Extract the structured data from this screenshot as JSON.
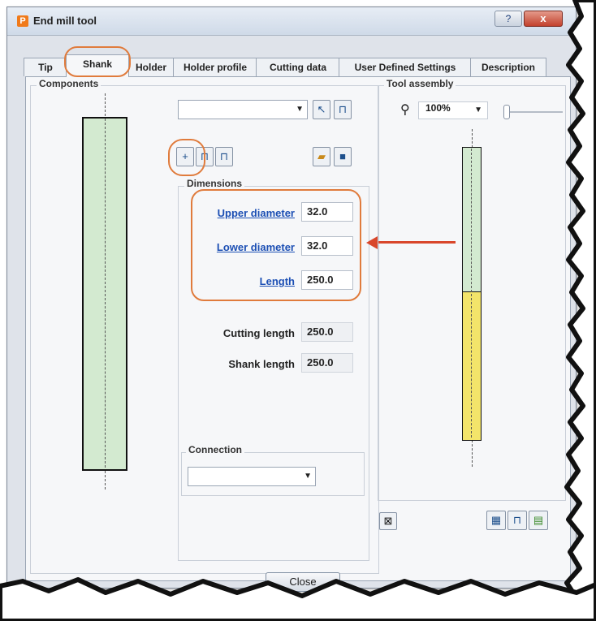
{
  "window": {
    "title": "End mill tool",
    "help_label": "?",
    "close_label": "x"
  },
  "tabs": [
    {
      "label": "Tip",
      "active": false
    },
    {
      "label": "Shank",
      "active": true
    },
    {
      "label": "Holder",
      "active": false
    },
    {
      "label": "Holder profile",
      "active": false
    },
    {
      "label": "Cutting data",
      "active": false
    },
    {
      "label": "User Defined Settings",
      "active": false
    },
    {
      "label": "Description",
      "active": false
    }
  ],
  "components": {
    "label": "Components"
  },
  "toolbar": {
    "component_select_value": "",
    "icons": [
      "select-pointer-icon",
      "select-shank-icon",
      "add-shank-icon",
      "shank-variant-icon",
      "shank-align-icon",
      "open-folder-icon",
      "save-icon"
    ]
  },
  "dimensions": {
    "label": "Dimensions",
    "upper_diameter_label": "Upper diameter",
    "upper_diameter_value": "32.0",
    "lower_diameter_label": "Lower diameter",
    "lower_diameter_value": "32.0",
    "length_label": "Length",
    "length_value": "250.0",
    "cutting_length_label": "Cutting length",
    "cutting_length_value": "250.0",
    "shank_length_label": "Shank length",
    "shank_length_value": "250.0"
  },
  "connection": {
    "label": "Connection",
    "value": ""
  },
  "tool_assembly": {
    "label": "Tool assembly",
    "zoom": "100%",
    "shank_color": "#d3ead0",
    "holder_color": "#f3e46a"
  },
  "bottom_icons": [
    "fit-view-icon",
    "assembly-view-icon",
    "shank-view-icon",
    "holder-view-icon"
  ],
  "footer": {
    "close_label": "Close"
  },
  "annotation_color": "#e07b3c"
}
